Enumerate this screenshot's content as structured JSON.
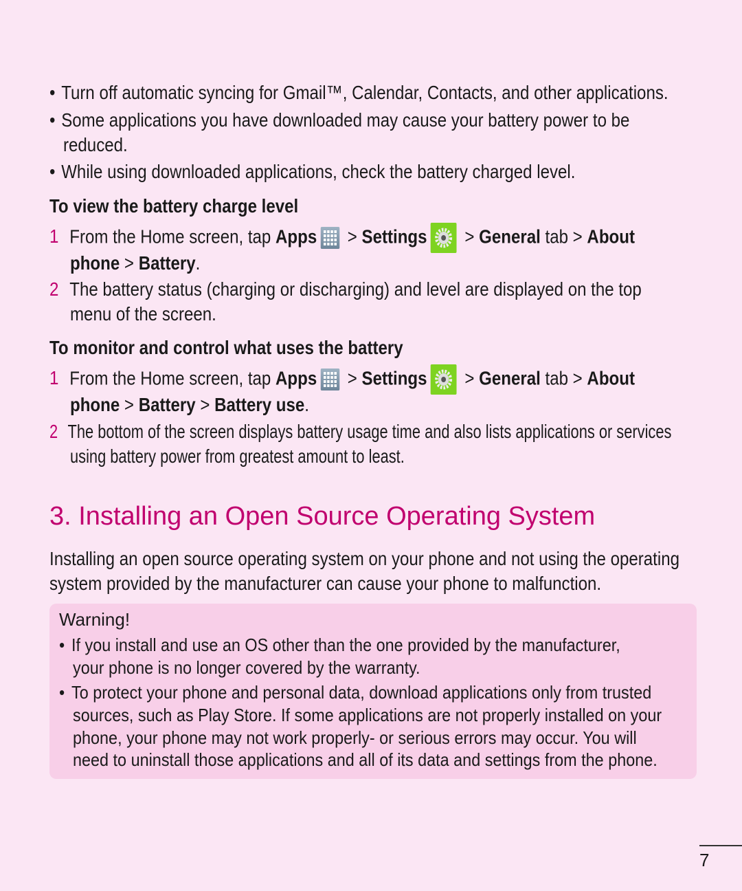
{
  "bullets": [
    "Turn off automatic syncing for Gmail™, Calendar, Contacts, and other applications.",
    "Some applications you have downloaded may cause your battery power to be",
    "reduced.",
    "While using downloaded applications, check the battery charged level."
  ],
  "section1": {
    "heading": "To view the battery charge level",
    "step1": {
      "num": "1",
      "pre": "From the Home screen, tap ",
      "apps": "Apps",
      "gt": " > ",
      "settings": "Settings",
      "general": "General",
      "tab": " tab > ",
      "about": "About",
      "line2_a": "phone",
      "line2_b": "Battery",
      "end": "."
    },
    "step2": {
      "num": "2",
      "line1": "The battery status (charging or discharging) and level are displayed on the top",
      "line2": "menu of the screen."
    }
  },
  "section2": {
    "heading": "To monitor and control what uses the battery",
    "step1": {
      "num": "1",
      "pre": "From the Home screen, tap ",
      "apps": "Apps",
      "gt": " > ",
      "settings": "Settings",
      "general": "General",
      "tab": " tab > ",
      "about": "About",
      "line2_a": "phone",
      "line2_b": "Battery",
      "line2_c": "Battery use",
      "end": "."
    },
    "step2": {
      "num": "2",
      "line1": "The bottom of the screen displays battery usage time and also lists applications or services",
      "line2": "using battery power from greatest amount to least."
    }
  },
  "main_title": "3. Installing an Open Source Operating System",
  "paragraph": [
    "Installing an open source operating system on your phone and not using the operating",
    "system provided by the manufacturer can cause your phone to malfunction."
  ],
  "warning": {
    "heading": "Warning!",
    "lines": [
      "If you install and use an OS other than the one provided by the manufacturer,",
      "your phone is no longer covered by the warranty.",
      "To protect your phone and personal data, download applications only from trusted",
      "sources, such as Play Store. If some applications are not properly installed on your",
      "phone, your phone may not work properly- or serious errors may occur. You will",
      "need to uninstall those applications and all of its data and settings from the phone."
    ]
  },
  "page_number": "7",
  "colors": {
    "accent": "#c0006e",
    "background": "#fbe6f4",
    "warning_bg": "#f8cfe8",
    "settings_icon": "#7ed321"
  }
}
